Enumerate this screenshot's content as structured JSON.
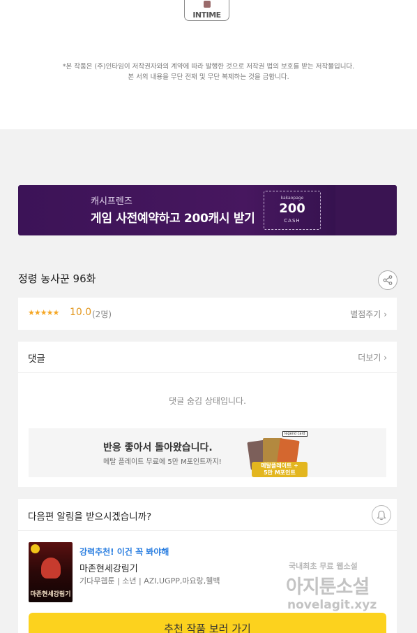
{
  "logo": {
    "text": "INTIME"
  },
  "copyright": {
    "line1": "*본 작품은 (주)인타임이 저작권자와의 계약에 따라 발행한 것으로 저작권 법의 보호를 받는 저작물입니다.",
    "line2": "본 서의 내용을 무단 전재 및 무단 복제하는 것을 금합니다."
  },
  "banner": {
    "subtitle": "캐시프렌즈",
    "title": "게임 사전예약하고 200캐시 받기",
    "coupon_brand": "kakaopage",
    "coupon_amount": "200",
    "coupon_unit": "CASH"
  },
  "episode": {
    "title": "정령 농사꾼 96화",
    "share_icon": "share-icon"
  },
  "rating": {
    "stars": "★★★★★",
    "score": "10.0",
    "count": "(2명)",
    "rate_label": "별점주기"
  },
  "comments": {
    "title": "댓글",
    "more_label": "더보기",
    "hidden_notice": "댓글 숨김 상태입니다.",
    "ad": {
      "title": "반응 좋아서 돌아왔습니다.",
      "subtitle": "메탈 플레이트 무료에 5만 M포인트까지!",
      "tag": "legend card",
      "bonus_line1": "메탈플레이트 +",
      "bonus_line2": "5만 M포인트"
    }
  },
  "next": {
    "question": "다음편 알림을 받으시겠습니까?",
    "bell_icon": "bell-icon",
    "rec_tag": "강력추천! 이건 꼭 봐야해",
    "rec_title": "마존현세강림기",
    "rec_meta": "기다무웹툰 | 소년 | AZI,UGPP,마요랑,웰백",
    "cover_title": "마존현세강림기",
    "rec_button": "추천 작품 보러 가기"
  },
  "watermark": {
    "line1": "국내최초 무료 웹소설",
    "line2": "아지툰소설",
    "line3": "novelagit.xyz"
  },
  "colors": {
    "banner": "#47175f",
    "accent": "#fcd21e",
    "link": "#2a7ee0",
    "rating": "#e2961c"
  }
}
